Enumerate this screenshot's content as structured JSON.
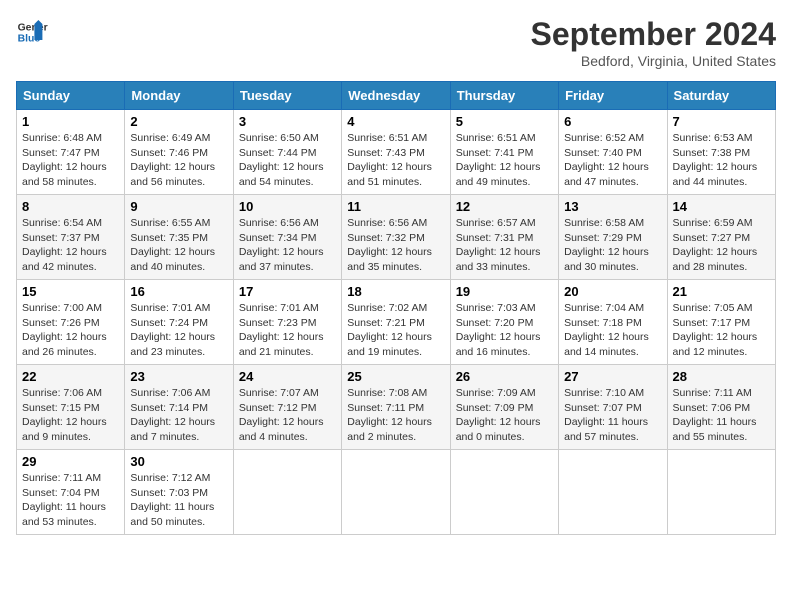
{
  "header": {
    "logo_line1": "General",
    "logo_line2": "Blue",
    "month_title": "September 2024",
    "location": "Bedford, Virginia, United States"
  },
  "weekdays": [
    "Sunday",
    "Monday",
    "Tuesday",
    "Wednesday",
    "Thursday",
    "Friday",
    "Saturday"
  ],
  "weeks": [
    [
      {
        "day": "1",
        "sunrise": "Sunrise: 6:48 AM",
        "sunset": "Sunset: 7:47 PM",
        "daylight": "Daylight: 12 hours and 58 minutes."
      },
      {
        "day": "2",
        "sunrise": "Sunrise: 6:49 AM",
        "sunset": "Sunset: 7:46 PM",
        "daylight": "Daylight: 12 hours and 56 minutes."
      },
      {
        "day": "3",
        "sunrise": "Sunrise: 6:50 AM",
        "sunset": "Sunset: 7:44 PM",
        "daylight": "Daylight: 12 hours and 54 minutes."
      },
      {
        "day": "4",
        "sunrise": "Sunrise: 6:51 AM",
        "sunset": "Sunset: 7:43 PM",
        "daylight": "Daylight: 12 hours and 51 minutes."
      },
      {
        "day": "5",
        "sunrise": "Sunrise: 6:51 AM",
        "sunset": "Sunset: 7:41 PM",
        "daylight": "Daylight: 12 hours and 49 minutes."
      },
      {
        "day": "6",
        "sunrise": "Sunrise: 6:52 AM",
        "sunset": "Sunset: 7:40 PM",
        "daylight": "Daylight: 12 hours and 47 minutes."
      },
      {
        "day": "7",
        "sunrise": "Sunrise: 6:53 AM",
        "sunset": "Sunset: 7:38 PM",
        "daylight": "Daylight: 12 hours and 44 minutes."
      }
    ],
    [
      {
        "day": "8",
        "sunrise": "Sunrise: 6:54 AM",
        "sunset": "Sunset: 7:37 PM",
        "daylight": "Daylight: 12 hours and 42 minutes."
      },
      {
        "day": "9",
        "sunrise": "Sunrise: 6:55 AM",
        "sunset": "Sunset: 7:35 PM",
        "daylight": "Daylight: 12 hours and 40 minutes."
      },
      {
        "day": "10",
        "sunrise": "Sunrise: 6:56 AM",
        "sunset": "Sunset: 7:34 PM",
        "daylight": "Daylight: 12 hours and 37 minutes."
      },
      {
        "day": "11",
        "sunrise": "Sunrise: 6:56 AM",
        "sunset": "Sunset: 7:32 PM",
        "daylight": "Daylight: 12 hours and 35 minutes."
      },
      {
        "day": "12",
        "sunrise": "Sunrise: 6:57 AM",
        "sunset": "Sunset: 7:31 PM",
        "daylight": "Daylight: 12 hours and 33 minutes."
      },
      {
        "day": "13",
        "sunrise": "Sunrise: 6:58 AM",
        "sunset": "Sunset: 7:29 PM",
        "daylight": "Daylight: 12 hours and 30 minutes."
      },
      {
        "day": "14",
        "sunrise": "Sunrise: 6:59 AM",
        "sunset": "Sunset: 7:27 PM",
        "daylight": "Daylight: 12 hours and 28 minutes."
      }
    ],
    [
      {
        "day": "15",
        "sunrise": "Sunrise: 7:00 AM",
        "sunset": "Sunset: 7:26 PM",
        "daylight": "Daylight: 12 hours and 26 minutes."
      },
      {
        "day": "16",
        "sunrise": "Sunrise: 7:01 AM",
        "sunset": "Sunset: 7:24 PM",
        "daylight": "Daylight: 12 hours and 23 minutes."
      },
      {
        "day": "17",
        "sunrise": "Sunrise: 7:01 AM",
        "sunset": "Sunset: 7:23 PM",
        "daylight": "Daylight: 12 hours and 21 minutes."
      },
      {
        "day": "18",
        "sunrise": "Sunrise: 7:02 AM",
        "sunset": "Sunset: 7:21 PM",
        "daylight": "Daylight: 12 hours and 19 minutes."
      },
      {
        "day": "19",
        "sunrise": "Sunrise: 7:03 AM",
        "sunset": "Sunset: 7:20 PM",
        "daylight": "Daylight: 12 hours and 16 minutes."
      },
      {
        "day": "20",
        "sunrise": "Sunrise: 7:04 AM",
        "sunset": "Sunset: 7:18 PM",
        "daylight": "Daylight: 12 hours and 14 minutes."
      },
      {
        "day": "21",
        "sunrise": "Sunrise: 7:05 AM",
        "sunset": "Sunset: 7:17 PM",
        "daylight": "Daylight: 12 hours and 12 minutes."
      }
    ],
    [
      {
        "day": "22",
        "sunrise": "Sunrise: 7:06 AM",
        "sunset": "Sunset: 7:15 PM",
        "daylight": "Daylight: 12 hours and 9 minutes."
      },
      {
        "day": "23",
        "sunrise": "Sunrise: 7:06 AM",
        "sunset": "Sunset: 7:14 PM",
        "daylight": "Daylight: 12 hours and 7 minutes."
      },
      {
        "day": "24",
        "sunrise": "Sunrise: 7:07 AM",
        "sunset": "Sunset: 7:12 PM",
        "daylight": "Daylight: 12 hours and 4 minutes."
      },
      {
        "day": "25",
        "sunrise": "Sunrise: 7:08 AM",
        "sunset": "Sunset: 7:11 PM",
        "daylight": "Daylight: 12 hours and 2 minutes."
      },
      {
        "day": "26",
        "sunrise": "Sunrise: 7:09 AM",
        "sunset": "Sunset: 7:09 PM",
        "daylight": "Daylight: 12 hours and 0 minutes."
      },
      {
        "day": "27",
        "sunrise": "Sunrise: 7:10 AM",
        "sunset": "Sunset: 7:07 PM",
        "daylight": "Daylight: 11 hours and 57 minutes."
      },
      {
        "day": "28",
        "sunrise": "Sunrise: 7:11 AM",
        "sunset": "Sunset: 7:06 PM",
        "daylight": "Daylight: 11 hours and 55 minutes."
      }
    ],
    [
      {
        "day": "29",
        "sunrise": "Sunrise: 7:11 AM",
        "sunset": "Sunset: 7:04 PM",
        "daylight": "Daylight: 11 hours and 53 minutes."
      },
      {
        "day": "30",
        "sunrise": "Sunrise: 7:12 AM",
        "sunset": "Sunset: 7:03 PM",
        "daylight": "Daylight: 11 hours and 50 minutes."
      },
      null,
      null,
      null,
      null,
      null
    ]
  ]
}
